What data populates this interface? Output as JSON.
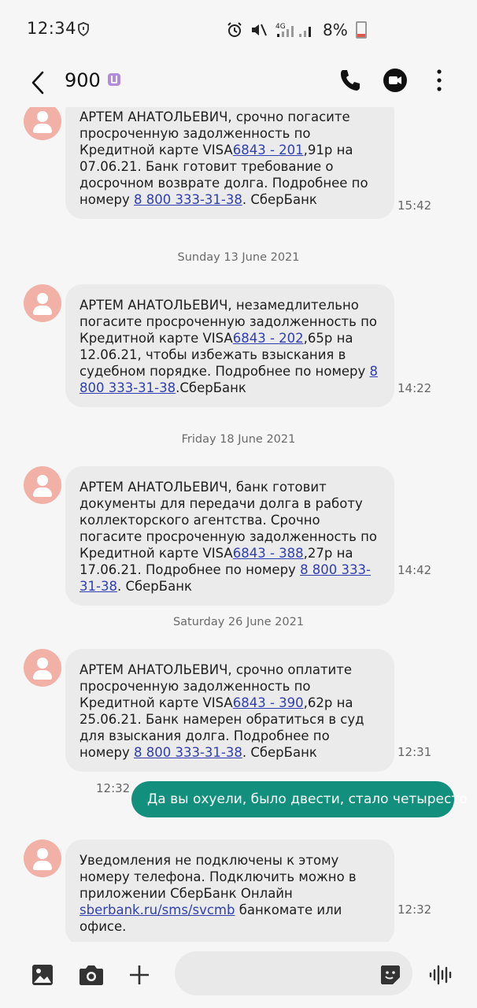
{
  "status_bar": {
    "time": "12:34",
    "battery_percent": "8%"
  },
  "header": {
    "contact_name": "900"
  },
  "messages": [
    {
      "parts": [
        "АРТЕМ АНАТОЛЬЕВИЧ, срочно погасите просроченную задолженность по Кредитной карте VISA",
        "6843 - 201",
        ",91р на 07.06.21. Банк готовит требование о досрочном возврате долга. Подробнее по номеру ",
        "8 800 333-31-38",
        ". СберБанк"
      ],
      "time": "15:42"
    },
    {
      "date_separator": "Sunday 13 June 2021"
    },
    {
      "parts": [
        "АРТЕМ АНАТОЛЬЕВИЧ, незамедлительно погасите просроченную задолженность по Кредитной карте VISA",
        "6843 - 202",
        ",65р на 12.06.21, чтобы избежать взыскания в судебном порядке. Подробнее по номеру ",
        "8 800 333-31-38",
        ".СберБанк"
      ],
      "time": "14:22"
    },
    {
      "date_separator": "Friday 18 June 2021"
    },
    {
      "parts": [
        "АРТЕМ АНАТОЛЬЕВИЧ, банк готовит документы для передачи долга в работу коллекторского агентства. Срочно погасите просроченную задолженность по Кредитной карте VISA",
        "6843 - 388",
        ",27р на 17.06.21. Подробнее по номеру ",
        "8 800 333-31-38",
        ". СберБанк"
      ],
      "time": "14:42"
    },
    {
      "date_separator": "Saturday 26 June 2021"
    },
    {
      "parts": [
        "АРТЕМ АНАТОЛЬЕВИЧ, срочно оплатите просроченную задолженность по Кредитной карте VISA",
        "6843 - 390",
        ",62р на 25.06.21. Банк намерен обратиться в суд для взыскания долга. Подробнее по номеру ",
        "8 800 333-31-38",
        ". СберБанк"
      ],
      "time": "12:31"
    },
    {
      "outgoing_text": "Да вы охуели, было двести, стало четыресто",
      "time": "12:32"
    },
    {
      "parts": [
        "Уведомления не подключены к этому номеру телефона. Подключить можно в приложении СберБанк Онлайн ",
        "sberbank.ru/sms/svcmb",
        " банкомате или офисе."
      ],
      "time": "12:32"
    }
  ],
  "icons": {
    "back": "back-arrow-icon",
    "call": "phone-icon",
    "video": "video-call-icon",
    "more": "more-vertical-icon",
    "gallery": "image-icon",
    "camera": "camera-icon",
    "add": "plus-icon",
    "sticker": "sticker-icon",
    "voice": "voice-wave-icon"
  },
  "colors": {
    "avatar": "#f2b1a6",
    "incoming_bubble": "#ebebeb",
    "outgoing_bubble": "#138f7e",
    "link": "#2f3fb0"
  }
}
